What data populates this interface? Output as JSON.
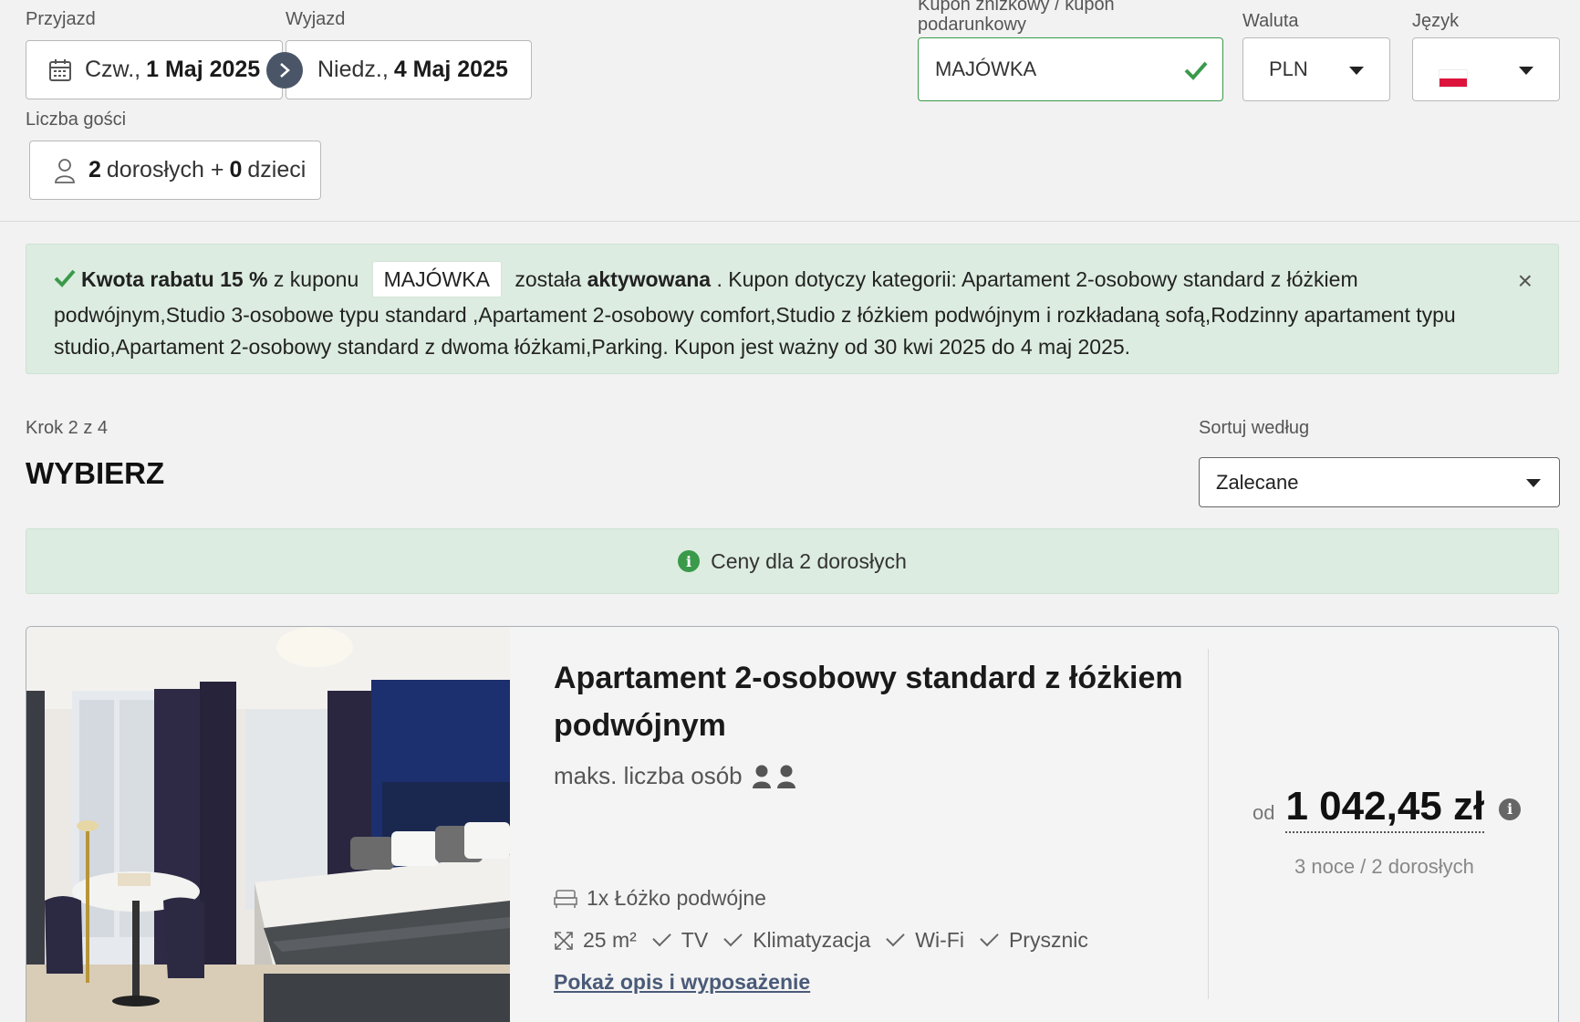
{
  "search": {
    "arrival_label": "Przyjazd",
    "departure_label": "Wyjazd",
    "arrival_day": "Czw.,",
    "arrival_date": "1 Maj 2025",
    "departure_day": "Niedz.,",
    "departure_date": "4 Maj 2025",
    "guests_label": "Liczba gości",
    "adults_count": "2",
    "adults_text": "dorosłych +",
    "children_count": "0",
    "children_text": "dzieci",
    "coupon_label_line1": "Kupon zniżkowy / kupon",
    "coupon_label_line2": "podarunkowy",
    "coupon_value": "MAJÓWKA",
    "currency_label": "Waluta",
    "currency_value": "PLN",
    "language_label": "Język",
    "language_flag": "flag-pl"
  },
  "alert": {
    "bold1": "Kwota rabatu 15 %",
    "text1": "z kuponu",
    "coupon": "MAJÓWKA",
    "text2": "została",
    "bold2": "aktywowana",
    "text3": ". Kupon dotyczy kategorii: Apartament 2-osobowy standard z łóżkiem podwójnym,Studio 3-osobowe typu standard ,Apartament 2-osobowy comfort,Studio z łóżkiem podwójnym i rozkładaną sofą,Rodzinny apartament typu studio,Apartament 2-osobowy standard z dwoma łóżkami,Parking. Kupon jest ważny od 30 kwi 2025 do 4 maj 2025.",
    "close": "×"
  },
  "step": {
    "label": "Krok 2 z 4",
    "title": "WYBIERZ",
    "sort_label": "Sortuj według",
    "sort_value": "Zalecane"
  },
  "info": {
    "text": "Ceny dla 2 dorosłych"
  },
  "room": {
    "title_line1": "Apartament 2-osobowy standard z łóżkiem",
    "title_line2": "podwójnym",
    "max_persons": "maks. liczba osób",
    "bed": "1x Łóżko podwójne",
    "area": "25 m²",
    "amenities": [
      "TV",
      "Klimatyzacja",
      "Wi-Fi",
      "Prysznic"
    ],
    "details_link": "Pokaż opis i wyposażenie",
    "price_prefix": "od",
    "price": "1 042,45 zł",
    "price_note": "3 noce / 2 dorosłych"
  }
}
